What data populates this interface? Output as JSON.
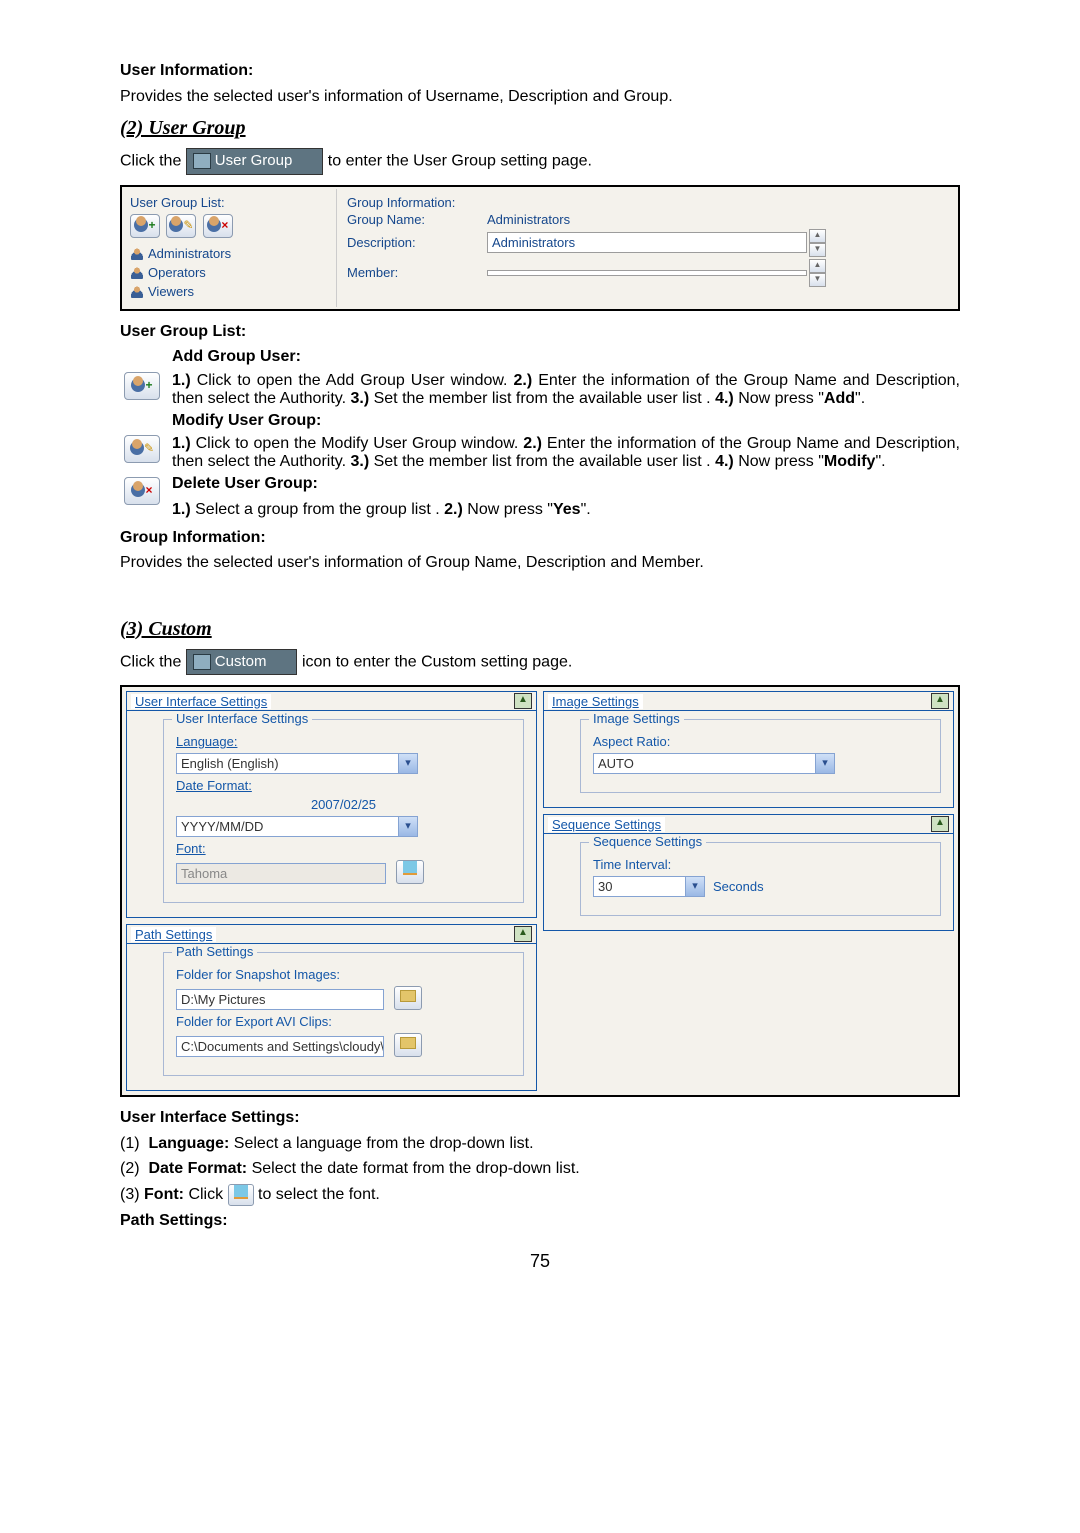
{
  "section1": {
    "title": "User Information:",
    "desc": "Provides the selected user's information of Username, Description and Group."
  },
  "section2": {
    "heading": "(2) User Group",
    "click_pre": "Click the ",
    "tab_label": "User Group",
    "click_post": " to enter the User Group setting page."
  },
  "usergroup_panel": {
    "list_label": "User Group List:",
    "items": [
      "Administrators",
      "Operators",
      "Viewers"
    ],
    "info_label": "Group Information:",
    "row1_k": "Group Name:",
    "row1_v": "Administrators",
    "row2_k": "Description:",
    "row2_v": "Administrators",
    "row3_k": "Member:",
    "row3_v": ""
  },
  "ugl_desc": {
    "title": "User Group List:",
    "add_title": "Add Group User:",
    "add_body_1": "1.)",
    "add_body_text1": " Click to open the Add Group User window. ",
    "add_body_2": "2.)",
    "add_body_text2": " Enter the information of the Group Name and Description, then select the Authority. ",
    "add_body_3": "3.)",
    "add_body_text3": " Set the member list from the available user list . ",
    "add_body_4": "4.)",
    "add_body_text4": " Now press \"",
    "add_word": "Add",
    "add_close": "\".",
    "mod_title": "Modify User Group:",
    "mod_text1": " Click to open the Modify User Group window. ",
    "mod_word": "Modify",
    "del_title": "Delete User Group:",
    "del_1": "1.)",
    "del_text1": " Select a group from the group list .",
    "del_2": "2.)",
    "del_text2": " Now press \"",
    "del_word": "Yes",
    "del_close": "\"."
  },
  "group_info": {
    "title": "Group Information:",
    "desc": "Provides the selected user's information of Group Name, Description and Member."
  },
  "section3": {
    "heading": "(3) Custom",
    "click_pre": "Click the ",
    "tab_label": "Custom",
    "click_post": " icon to enter the Custom setting page."
  },
  "custom_panel": {
    "uis": {
      "head": "User Interface Settings",
      "legend": "User Interface Settings",
      "language_label": "Language:",
      "language_value": "English (English)",
      "date_label": "Date Format:",
      "date_sample": "2007/02/25",
      "date_value": "YYYY/MM/DD",
      "font_label": "Font:",
      "font_value": "Tahoma"
    },
    "path": {
      "head": "Path Settings",
      "legend": "Path Settings",
      "snap_label": "Folder for Snapshot Images:",
      "snap_value": "D:\\My Pictures",
      "avi_label": "Folder for Export AVI Clips:",
      "avi_value": "C:\\Documents and Settings\\cloudy\\My"
    },
    "img": {
      "head": "Image Settings",
      "legend": "Image Settings",
      "aspect_label": "Aspect Ratio:",
      "aspect_value": "AUTO"
    },
    "seq": {
      "head": "Sequence Settings",
      "legend": "Sequence Settings",
      "interval_label": "Time Interval:",
      "interval_value": "30",
      "seconds": "Seconds"
    }
  },
  "uis_desc": {
    "title": "User Interface Settings:",
    "l1_num": "(1)",
    "l1_b": "Language:",
    "l1_t": " Select a language from the drop-down list.",
    "l2_num": "(2)",
    "l2_b": "Date Format:",
    "l2_t": " Select the date format from the drop-down list.",
    "l3_num": "(3)",
    "l3_b": "Font:",
    "l3_pre": " Click ",
    "l3_post": " to select the font.",
    "path_title": "Path Settings:"
  },
  "page_number": "75"
}
